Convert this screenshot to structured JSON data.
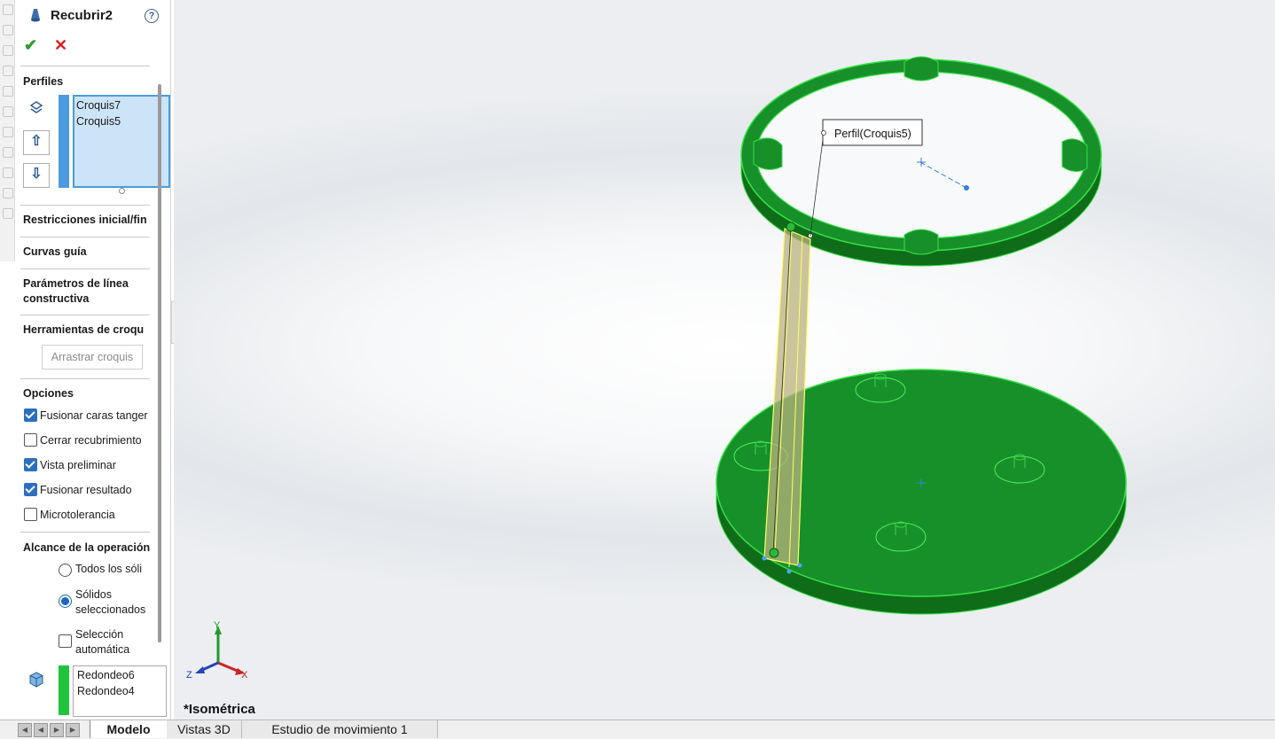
{
  "feature": {
    "title": "Recubrir2",
    "help_label": "?",
    "ok_label": "✔",
    "cancel_label": "✕"
  },
  "profiles": {
    "title": "Perfiles",
    "items": [
      "Croquis7",
      "Croquis5"
    ],
    "up_label": "⇧",
    "down_label": "⇩"
  },
  "sections": {
    "start_end_constraints": "Restricciones inicial/fin",
    "guide_curves": "Curvas guía",
    "centerline_params_line1": "Parámetros de línea",
    "centerline_params_line2": "constructiva",
    "sketch_tools": "Herramientas de croqu",
    "drag_sketch_button": "Arrastrar croquis"
  },
  "options": {
    "title": "Opciones",
    "items": [
      {
        "label": "Fusionar caras tanger",
        "checked": true
      },
      {
        "label": "Cerrar recubrimiento",
        "checked": false
      },
      {
        "label": "Vista preliminar",
        "checked": true
      },
      {
        "label": "Fusionar resultado",
        "checked": true
      },
      {
        "label": "Microtolerancia",
        "checked": false
      }
    ]
  },
  "feature_scope": {
    "title": "Alcance de la operación",
    "all_bodies": "Todos los sóli",
    "selected_line1": "Sólidos",
    "selected_line2": "seleccionados",
    "auto_line1": "Selección",
    "auto_line2": "automática",
    "selected_option": "selected_bodies",
    "auto_select_checked": false,
    "bodies": [
      "Redondeo6",
      "Redondeo4"
    ]
  },
  "viewport": {
    "callout": "Perfil(Croquis5)",
    "view_name": "*Isométrica",
    "triad": {
      "x": "X",
      "y": "Y",
      "z": "Z"
    }
  },
  "tabs": [
    "Modelo",
    "Vistas 3D",
    "Estudio de movimiento 1"
  ],
  "colors": {
    "model_green": "#1f9b2c",
    "selection_blue": "#4a9be0",
    "preview_yellow": "#ffff66",
    "bodies_bar_green": "#1fc43c"
  }
}
